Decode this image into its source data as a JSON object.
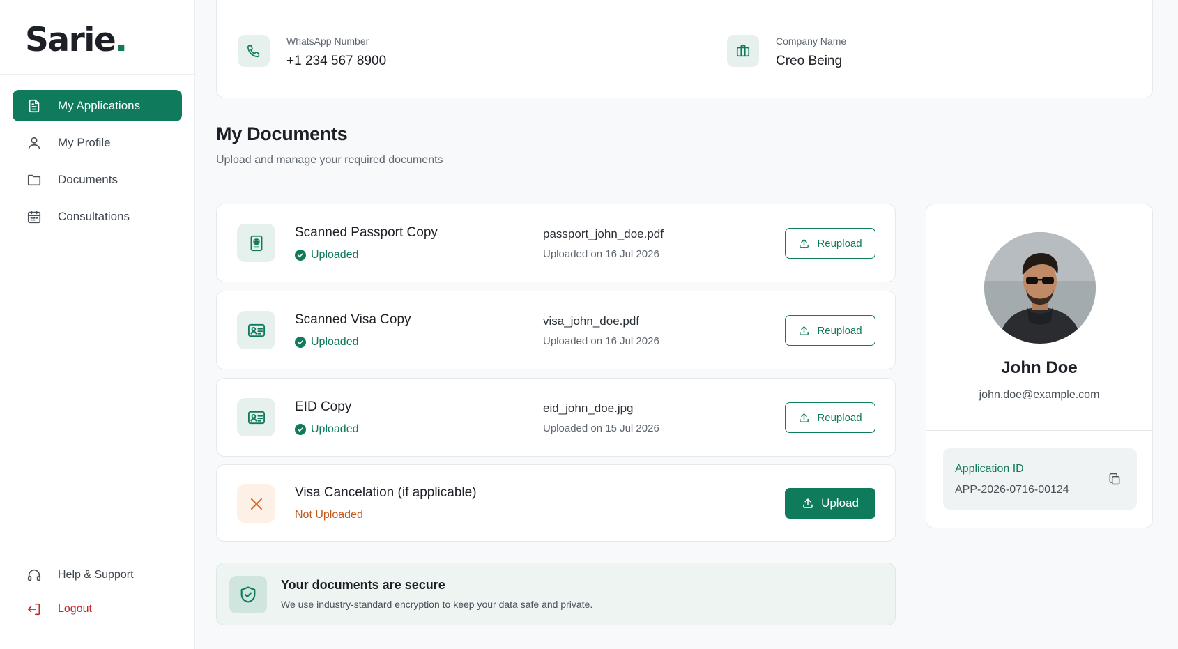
{
  "brand": {
    "name": "Sarie",
    "dot": ".",
    "accent": "#0f7a5c"
  },
  "sidebar": {
    "items": [
      {
        "label": "My Applications",
        "icon": "file-text-icon",
        "active": true
      },
      {
        "label": "My Profile",
        "icon": "user-icon"
      },
      {
        "label": "Documents",
        "icon": "folder-icon"
      },
      {
        "label": "Consultations",
        "icon": "calendar-icon"
      }
    ],
    "bottom": [
      {
        "label": "Help & Support",
        "icon": "headset-icon"
      },
      {
        "label": "Logout",
        "icon": "logout-icon",
        "color": "#c62828"
      }
    ]
  },
  "contact": {
    "whatsapp_label": "WhatsApp Number",
    "whatsapp_value": "+1 234 567 8900",
    "company_label": "Company Name",
    "company_value": "Creo Being"
  },
  "documents": {
    "title": "My Documents",
    "subtitle": "Upload and manage your required documents",
    "items": [
      {
        "name": "Scanned Passport Copy",
        "status": "Uploaded",
        "file": "passport_john_doe.pdf",
        "date": "Uploaded on 16 Jul 2026",
        "action": "Reupload",
        "icon": "passport-icon"
      },
      {
        "name": "Scanned Visa Copy",
        "status": "Uploaded",
        "file": "visa_john_doe.pdf",
        "date": "Uploaded on 16 Jul 2026",
        "action": "Reupload",
        "icon": "id-card-icon"
      },
      {
        "name": "EID Copy",
        "status": "Uploaded",
        "file": "eid_john_doe.jpg",
        "date": "Uploaded on 15 Jul 2026",
        "action": "Reupload",
        "icon": "id-card-icon"
      },
      {
        "name": "Visa Cancelation (if applicable)",
        "status": "Not Uploaded",
        "action": "Upload",
        "icon": "x-icon"
      }
    ]
  },
  "secure": {
    "title": "Your documents are secure",
    "text": "We use industry-standard encryption to keep your data safe and private."
  },
  "profile": {
    "name": "John Doe",
    "email": "john.doe@example.com",
    "app_id_label": "Application ID",
    "app_id_value": "APP-2026-0716-00124"
  }
}
